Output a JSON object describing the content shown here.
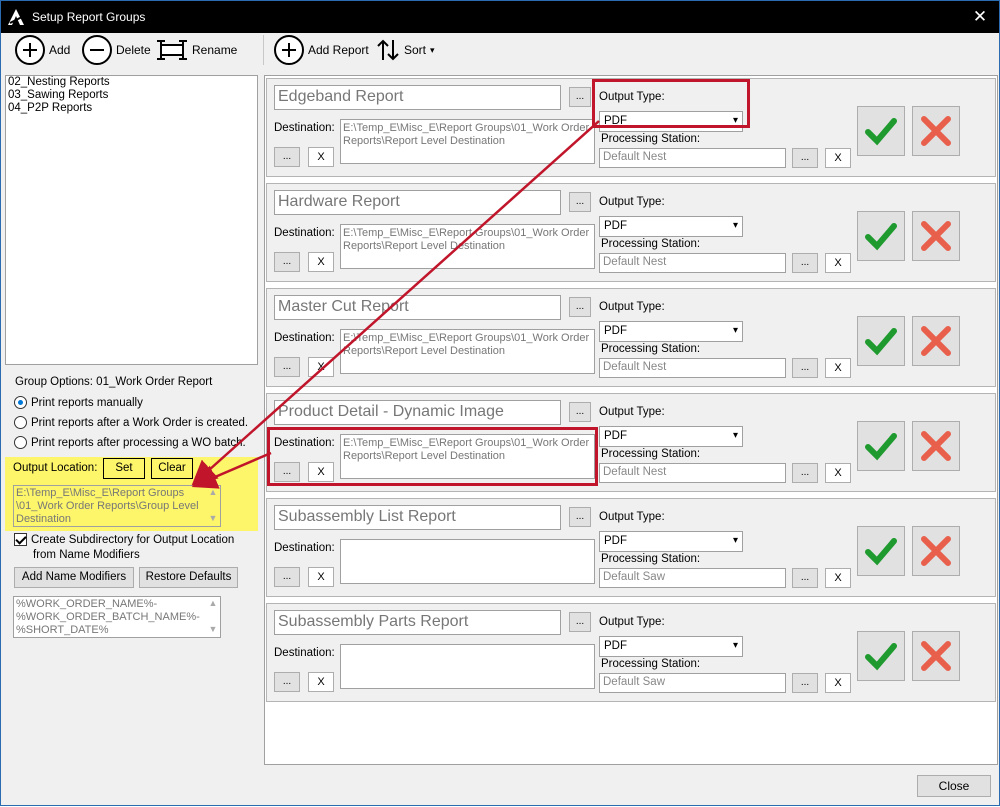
{
  "window": {
    "title": "Setup Report Groups",
    "close": "✕"
  },
  "toolbar": {
    "add": "Add",
    "delete": "Delete",
    "rename": "Rename",
    "add_report": "Add Report",
    "sort": "Sort",
    "sort_arrow": "▾"
  },
  "groups": [
    "01_Work Order Report",
    "02_Nesting Reports",
    "03_Sawing Reports",
    "04_P2P Reports"
  ],
  "options": {
    "heading": "Group Options: 01_Work Order Report",
    "radios": [
      "Print reports manually",
      "Print reports after a Work Order is created.",
      "Print reports after processing a WO batch."
    ],
    "output_location_label": "Output Location:",
    "set": "Set",
    "clear": "Clear",
    "output_location_value": "E:\\Temp_E\\Misc_E\\Report Groups\n\\01_Work Order Reports\\Group Level\nDestination",
    "create_subdir_line1": "Create Subdirectory for Output Location",
    "create_subdir_line2": "from Name Modifiers",
    "add_name_modifiers": "Add Name Modifiers",
    "restore_defaults": "Restore Defaults",
    "modifiers_value": "%WORK_ORDER_NAME%-\n%WORK_ORDER_BATCH_NAME%-\n%SHORT_DATE%"
  },
  "labels": {
    "destination": "Destination:",
    "output_type": "Output Type:",
    "processing_station": "Processing Station:",
    "dots": "...",
    "x": "X",
    "arrow": "▾",
    "up": "▲",
    "down": "▼"
  },
  "reports": [
    {
      "name": "Edgeband Report",
      "destination": "E:\\Temp_E\\Misc_E\\Report Groups\\01_Work Order Reports\\Report Level Destination",
      "output_type": "PDF",
      "station": "Default Nest"
    },
    {
      "name": "Hardware Report",
      "destination": "E:\\Temp_E\\Misc_E\\Report Groups\\01_Work Order Reports\\Report Level Destination",
      "output_type": "PDF",
      "station": "Default Nest"
    },
    {
      "name": "Master Cut Report",
      "destination": "E:\\Temp_E\\Misc_E\\Report Groups\\01_Work Order Reports\\Report Level Destination",
      "output_type": "PDF",
      "station": "Default Nest"
    },
    {
      "name": "Product Detail - Dynamic Image",
      "destination": "E:\\Temp_E\\Misc_E\\Report Groups\\01_Work Order Reports\\Report Level Destination",
      "output_type": "PDF",
      "station": "Default Nest"
    },
    {
      "name": "Subassembly List Report",
      "destination": "",
      "output_type": "PDF",
      "station": "Default Saw"
    },
    {
      "name": "Subassembly Parts Report",
      "destination": "",
      "output_type": "PDF",
      "station": "Default Saw"
    }
  ],
  "footer": {
    "close": "Close"
  },
  "colors": {
    "highlight": "#c0152a",
    "yellow": "#fdf56a",
    "ok_green": "#1f9a2e",
    "cancel_red": "#e8604b",
    "selection": "#0078d7"
  }
}
